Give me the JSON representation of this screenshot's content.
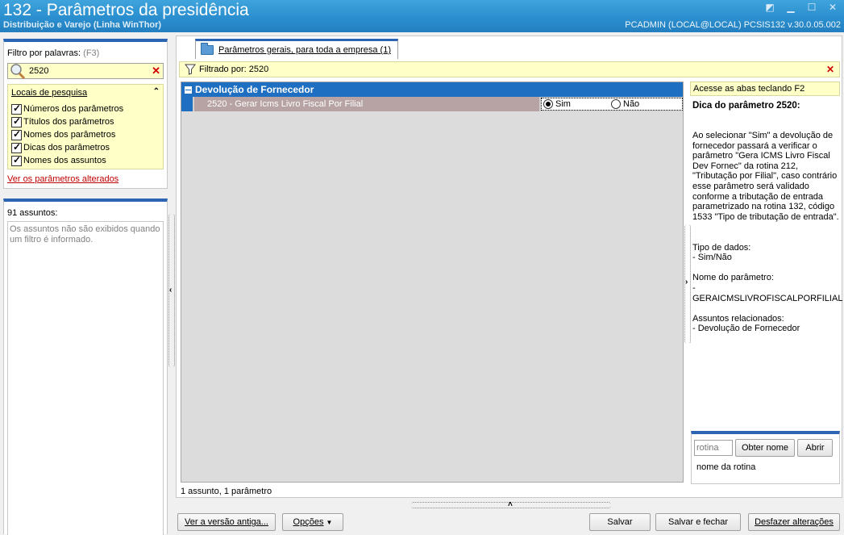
{
  "window": {
    "title": "132 - Parâmetros da presidência",
    "subtitle": "Distribuição e Varejo (Linha WinThor)",
    "user_info": "PCADMIN (LOCAL@LOCAL)   PCSIS132  v.30.0.05.002"
  },
  "filter": {
    "label": "Filtro por palavras:",
    "shortcut": "(F3)",
    "value": "2520"
  },
  "locais": {
    "header": "Locais de pesquisa",
    "options": [
      {
        "label": "Números dos parâmetros",
        "checked": true
      },
      {
        "label": "Títulos dos parâmetros",
        "checked": true
      },
      {
        "label": "Nomes dos parâmetros",
        "checked": true
      },
      {
        "label": "Dicas dos parâmetros",
        "checked": true
      },
      {
        "label": "Nomes dos assuntos",
        "checked": true
      }
    ],
    "link": "Ver os parâmetros alterados"
  },
  "assuntos": {
    "count_label": "91 assuntos:",
    "message": "Os assuntos não são exibidos quando um filtro é informado."
  },
  "tab": {
    "label": "Parâmetros gerais, para toda a empresa  (1)"
  },
  "filtered": {
    "label": "Filtrado por: 2520"
  },
  "grid": {
    "group": "Devolução de Fornecedor",
    "param_name": "2520 - Gerar Icms Livro Fiscal Por Filial",
    "option_yes": "Sim",
    "option_no": "Não",
    "selected": "Sim"
  },
  "status": "1 assunto, 1 parâmetro",
  "help": {
    "hint": "Acesse as abas teclando F2",
    "title": "Dica do parâmetro 2520:",
    "body": "Ao selecionar \"Sim\" a devolução de fornecedor passará a verificar o parâmetro \"Gera ICMS Livro Fiscal Dev Fornec\" da rotina 212, \"Tributação por Filial\", caso contrário esse parâmetro será validado conforme a tributação de entrada parametrizado na rotina 132, código 1533 \"Tipo de tributação de entrada\".\n\n\nTipo de dados:\n   - Sim/Não\n\nNome do parâmetro:\n   -\nGERAICMSLIVROFISCALPORFILIAL\n\nAssuntos relacionados:\n   - Devolução de Fornecedor"
  },
  "rotina": {
    "placeholder": "rotina",
    "obter_label": "Obter nome",
    "abrir_label": "Abrir",
    "name_label": "nome da rotina"
  },
  "footer": {
    "versao_antiga": "Ver a versão antiga...",
    "opcoes": "Opções",
    "salvar": "Salvar",
    "salvar_fechar": "Salvar e fechar",
    "desfazer": "Desfazer alterações"
  }
}
